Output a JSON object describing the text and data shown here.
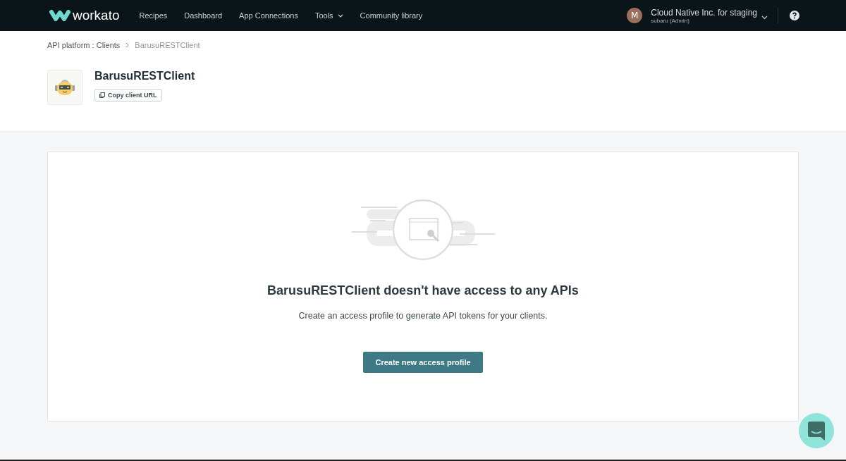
{
  "nav": {
    "logo": "workato",
    "items": [
      {
        "label": "Recipes",
        "dropdown": false
      },
      {
        "label": "Dashboard",
        "dropdown": false
      },
      {
        "label": "App Connections",
        "dropdown": false
      },
      {
        "label": "Tools",
        "dropdown": true
      },
      {
        "label": "Community library",
        "dropdown": false
      }
    ],
    "account": {
      "initial": "M",
      "name": "Cloud Native Inc. for staging",
      "role": "subaru (Admin)"
    }
  },
  "breadcrumb": [
    "API platform : Clients",
    "BarusuRESTClient"
  ],
  "client": {
    "name": "BarusuRESTClient",
    "copy_button": "Copy client URL"
  },
  "empty_state": {
    "title": "BarusuRESTClient doesn't have access to any APIs",
    "message": "Create an access profile to generate API tokens for your clients.",
    "button": "Create new access profile"
  }
}
